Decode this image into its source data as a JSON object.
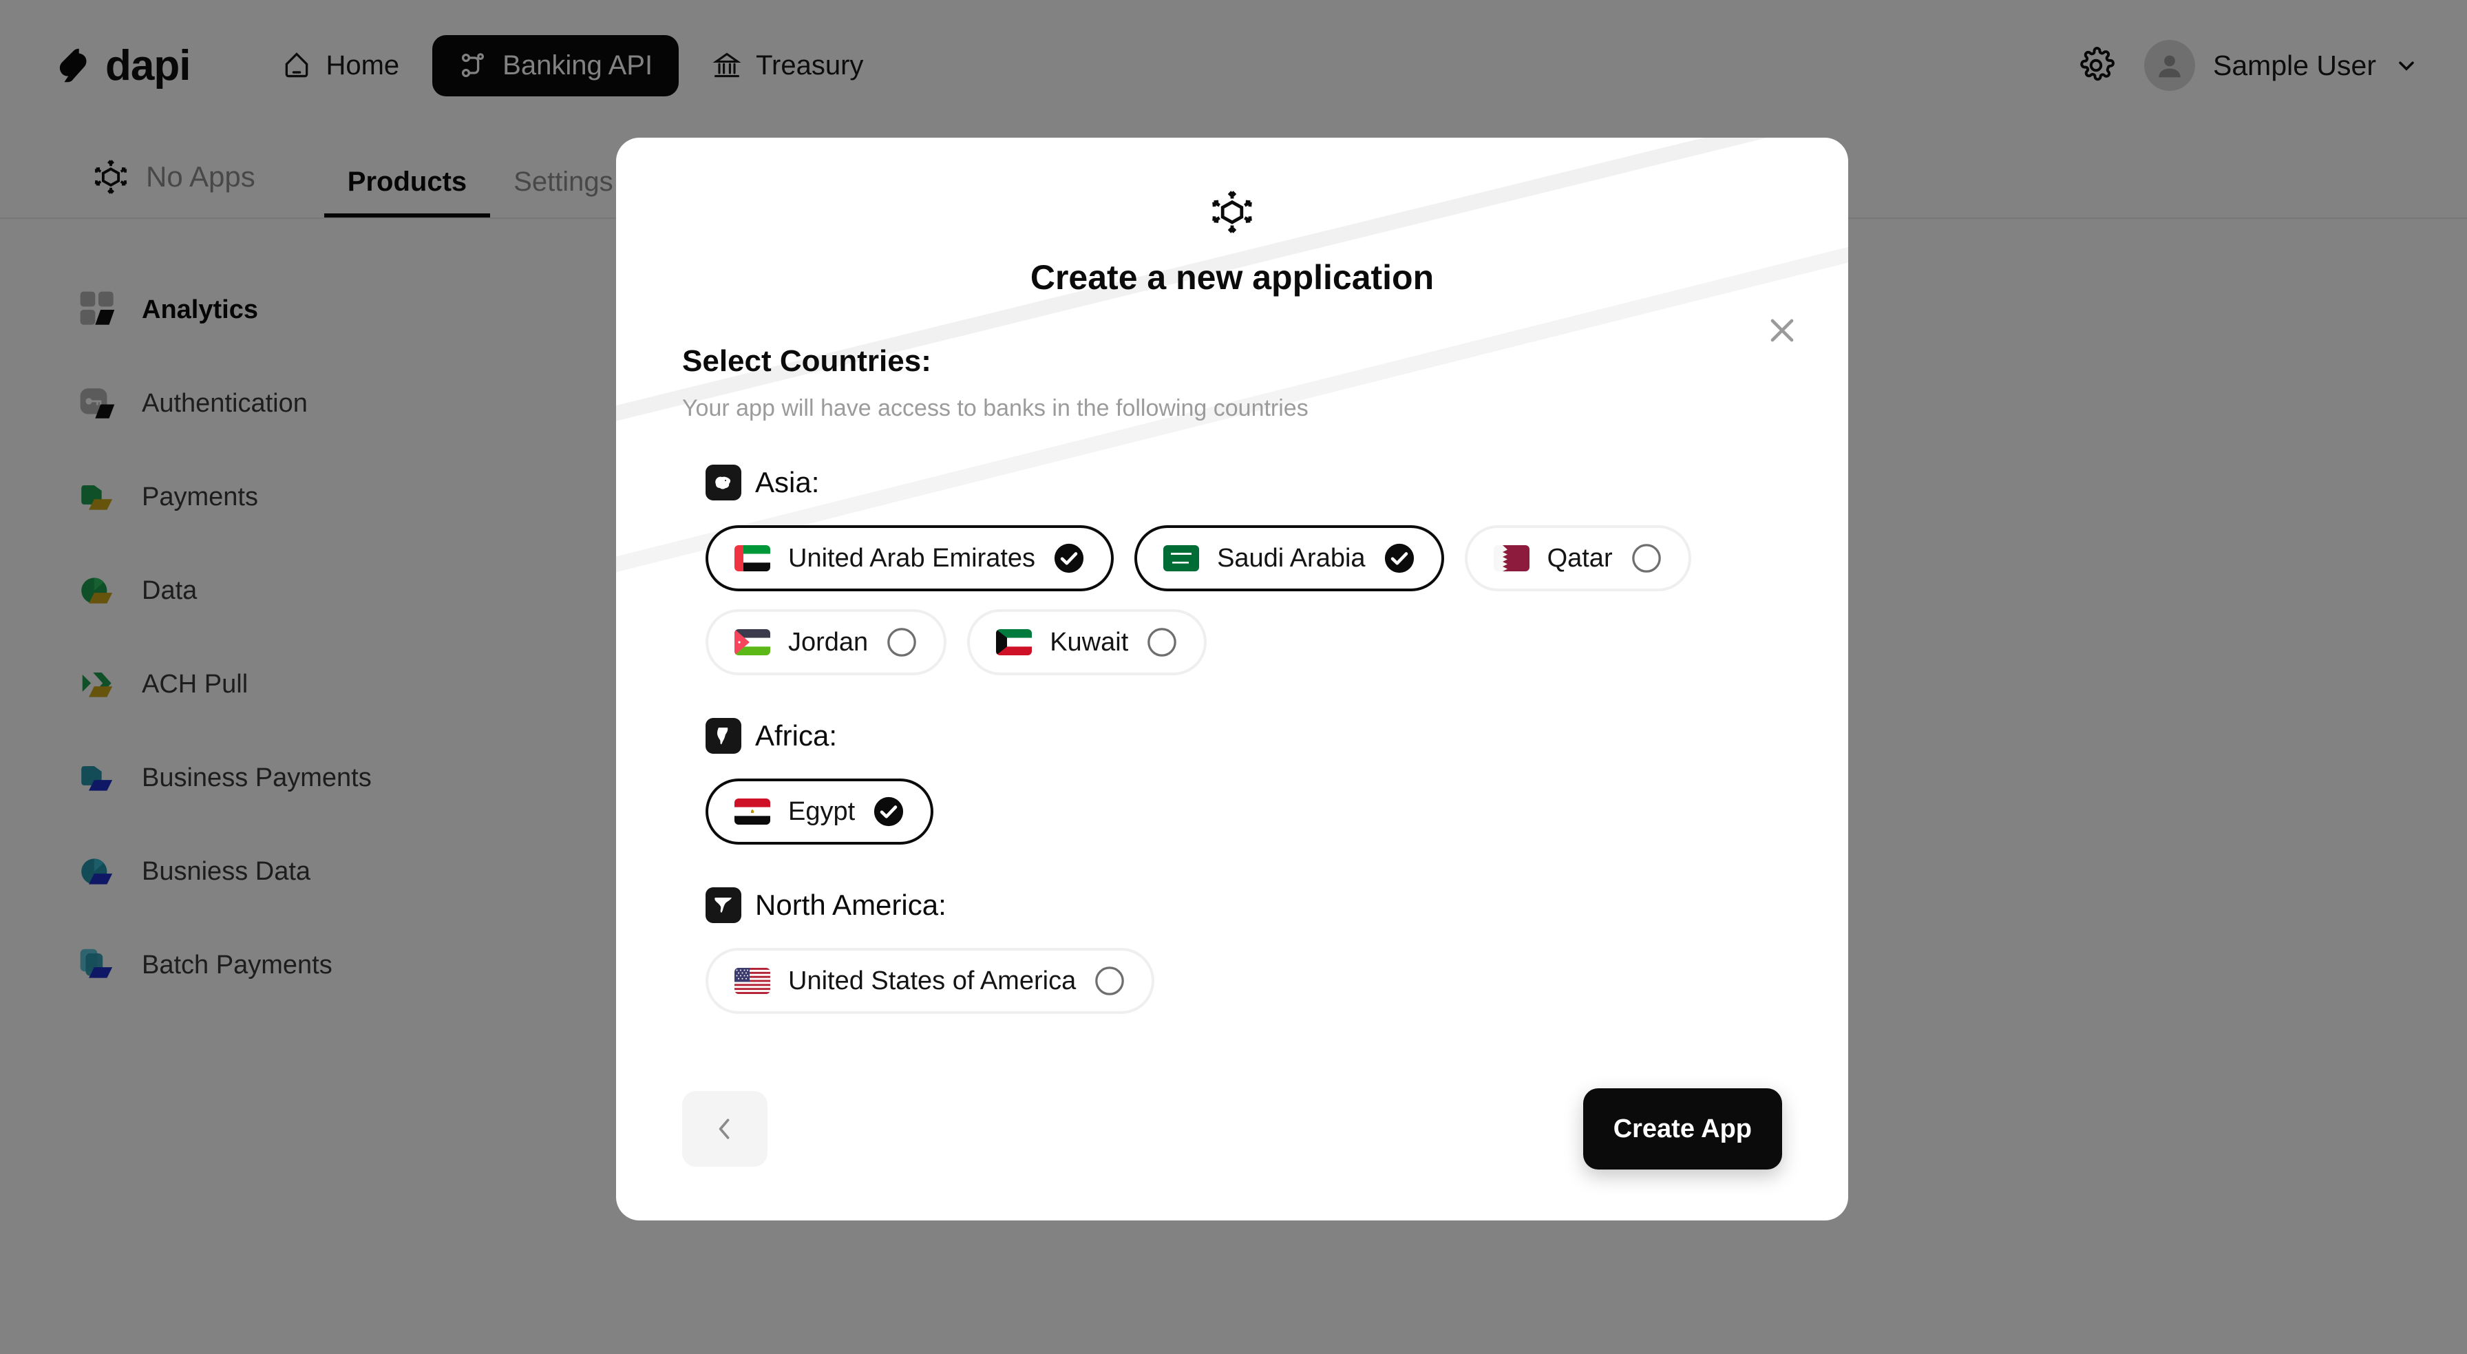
{
  "topnav": {
    "brand": "dapi",
    "brand_icon": "dapi-logo-icon",
    "items": [
      {
        "label": "Home",
        "icon": "home-icon",
        "active": false
      },
      {
        "label": "Banking API",
        "icon": "api-nodes-icon",
        "active": true
      },
      {
        "label": "Treasury",
        "icon": "bank-building-icon",
        "active": false
      }
    ],
    "settings_icon": "gear-icon",
    "user_name": "Sample User",
    "avatar_icon": "avatar-icon",
    "caret_icon": "chevron-down-icon"
  },
  "subheader": {
    "app_selector_label": "No Apps",
    "app_selector_icon": "cube-expand-icon",
    "tabs": [
      {
        "label": "Products",
        "active": true
      },
      {
        "label": "Settings",
        "active": false
      }
    ]
  },
  "sidebar": {
    "items": [
      {
        "label": "Analytics",
        "icon": "analytics-grid-icon",
        "active": true
      },
      {
        "label": "Authentication",
        "icon": "key-icon",
        "active": false
      },
      {
        "label": "Payments",
        "icon": "wallet-green-icon",
        "active": false
      },
      {
        "label": "Data",
        "icon": "pie-green-icon",
        "active": false
      },
      {
        "label": "ACH Pull",
        "icon": "chevrons-green-icon",
        "active": false
      },
      {
        "label": "Business Payments",
        "icon": "wallet-blue-icon",
        "active": false
      },
      {
        "label": "Busniess Data",
        "icon": "pie-blue-icon",
        "active": false
      },
      {
        "label": "Batch Payments",
        "icon": "stack-blue-icon",
        "active": false
      }
    ]
  },
  "modal": {
    "logo_icon": "cube-expand-icon",
    "title": "Create a new application",
    "close_icon": "close-icon",
    "section_title": "Select Countries:",
    "section_subtitle": "Your app will have access to banks in the following countries",
    "continents": [
      {
        "name": "Asia:",
        "icon": "asia-map-icon",
        "countries": [
          {
            "label": "United Arab Emirates",
            "flag": "flag-ae",
            "selected": true
          },
          {
            "label": "Saudi Arabia",
            "flag": "flag-sa",
            "selected": true
          },
          {
            "label": "Qatar",
            "flag": "flag-qa",
            "selected": false
          },
          {
            "label": "Jordan",
            "flag": "flag-jo",
            "selected": false
          },
          {
            "label": "Kuwait",
            "flag": "flag-kw",
            "selected": false
          }
        ]
      },
      {
        "name": "Africa:",
        "icon": "africa-map-icon",
        "countries": [
          {
            "label": "Egypt",
            "flag": "flag-eg",
            "selected": true
          }
        ]
      },
      {
        "name": "North America:",
        "icon": "north-america-map-icon",
        "countries": [
          {
            "label": "United States of America",
            "flag": "flag-us",
            "selected": false
          }
        ]
      }
    ],
    "back_label": "",
    "back_icon": "chevron-left-icon",
    "create_label": "Create App"
  },
  "colors": {
    "accent_black": "#0b0b0b",
    "muted_text": "#8d8d8d",
    "chip_border_unselected": "#efefef",
    "overlay": "#808080"
  }
}
